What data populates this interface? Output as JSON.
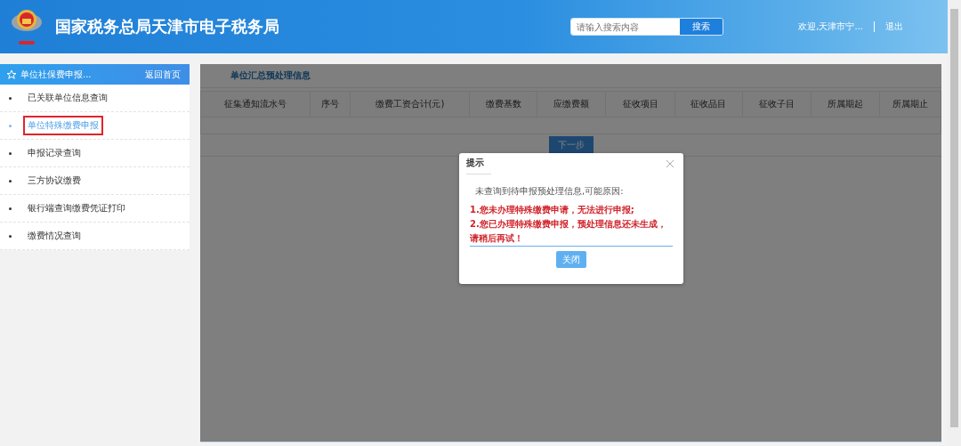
{
  "header": {
    "title": "国家税务总局天津市电子税务局",
    "search": {
      "placeholder": "请输入搜索内容"
    },
    "search_button": "搜索",
    "welcome": "欢迎,天津市宁...",
    "logout": "退出"
  },
  "sidebar": {
    "title": "单位社保费申报...",
    "back_link": "返回首页",
    "items": [
      {
        "label": "已关联单位信息查询",
        "selected": false
      },
      {
        "label": "单位特殊缴费申报",
        "selected": true
      },
      {
        "label": "申报记录查询",
        "selected": false
      },
      {
        "label": "三方协议缴费",
        "selected": false
      },
      {
        "label": "银行端查询缴费凭证打印",
        "selected": false
      },
      {
        "label": "缴费情况查询",
        "selected": false
      }
    ]
  },
  "main": {
    "title": "单位汇总预处理信息",
    "table": {
      "columns": [
        "征集通知流水号",
        "序号",
        "缴费工资合计(元)",
        "缴费基数",
        "应缴费额",
        "征收项目",
        "征收品目",
        "征收子目",
        "所属期起",
        "所属期止"
      ]
    },
    "next_button": "下一步",
    "dimmed": true
  },
  "dialog": {
    "title": "提示",
    "message": "未查询到待申报预处理信息,可能原因:",
    "reasons": [
      "1.您未办理特殊缴费申请，无法进行申报;",
      "2.您已办理特殊缴费申报，预处理信息还未生成，请稍后再试！"
    ],
    "close_button": "关闭"
  }
}
